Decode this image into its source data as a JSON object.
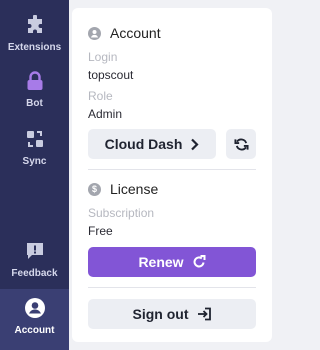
{
  "sidebar": {
    "items": [
      {
        "label": "Extensions",
        "icon": "puzzle-icon"
      },
      {
        "label": "Bot",
        "icon": "lock-icon"
      },
      {
        "label": "Sync",
        "icon": "sync-icon"
      },
      {
        "label": "Feedback",
        "icon": "feedback-icon"
      },
      {
        "label": "Account",
        "icon": "account-icon",
        "active": true
      }
    ]
  },
  "account": {
    "title": "Account",
    "login_label": "Login",
    "login_value": "topscout",
    "role_label": "Role",
    "role_value": "Admin",
    "cloud_dash_label": "Cloud Dash"
  },
  "license": {
    "title": "License",
    "subscription_label": "Subscription",
    "subscription_value": "Free",
    "renew_label": "Renew"
  },
  "signout_label": "Sign out",
  "colors": {
    "sidebar_bg": "#2b2f5a",
    "sidebar_active": "#3a3f73",
    "accent_purple": "#8255d6",
    "bot_icon": "#a77be8"
  }
}
